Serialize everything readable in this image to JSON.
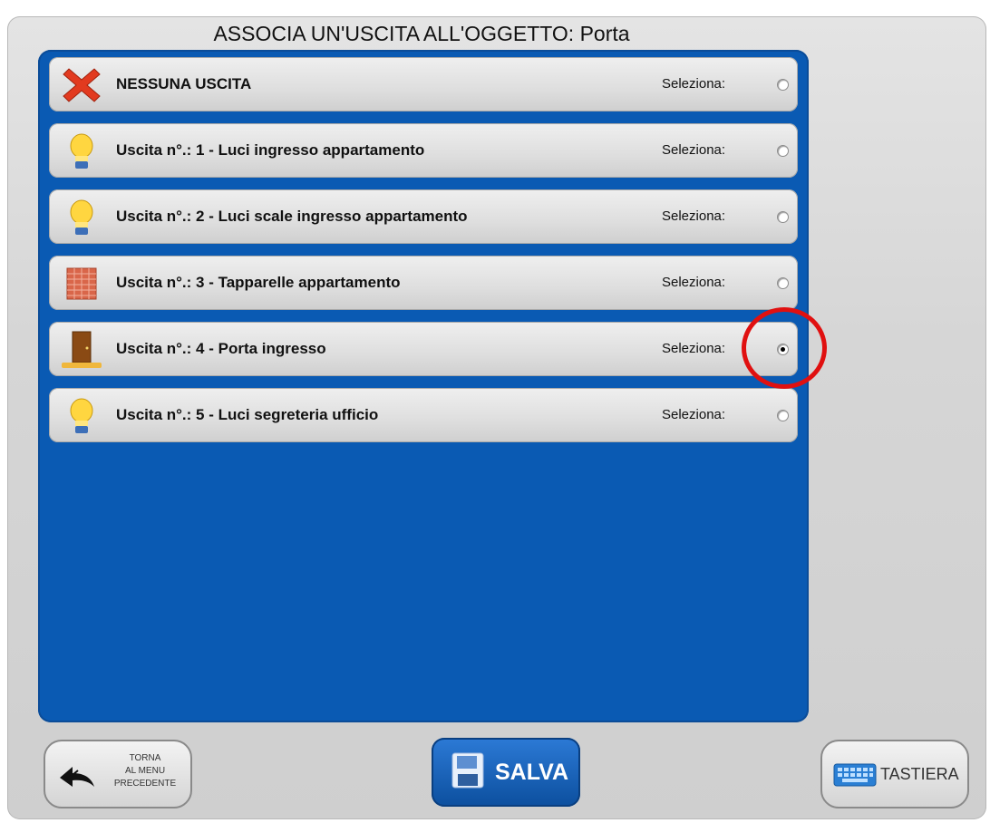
{
  "header": {
    "title": "ASSOCIA UN'USCITA ALL'OGGETTO: Porta"
  },
  "rows": [
    {
      "icon": "red-x-icon",
      "label": "NESSUNA USCITA",
      "select_label": "Seleziona:",
      "selected": false
    },
    {
      "icon": "lightbulb-icon",
      "label": "Uscita n°.: 1 - Luci ingresso appartamento",
      "select_label": "Seleziona:",
      "selected": false
    },
    {
      "icon": "lightbulb-icon",
      "label": "Uscita n°.: 2 - Luci scale ingresso appartamento",
      "select_label": "Seleziona:",
      "selected": false
    },
    {
      "icon": "shutter-icon",
      "label": "Uscita n°.: 3 - Tapparelle appartamento",
      "select_label": "Seleziona:",
      "selected": false
    },
    {
      "icon": "door-icon",
      "label": "Uscita n°.: 4 - Porta ingresso",
      "select_label": "Seleziona:",
      "selected": true
    },
    {
      "icon": "lightbulb-icon",
      "label": "Uscita n°.: 5 - Luci segreteria ufficio",
      "select_label": "Seleziona:",
      "selected": false
    }
  ],
  "footer": {
    "back_lines": [
      "TORNA",
      "AL MENU",
      "PRECEDENTE"
    ],
    "save_label": "SALVA",
    "keyboard_label": "TASTIERA"
  },
  "colors": {
    "panel": "#0a5ab3",
    "highlight": "#e01010"
  }
}
